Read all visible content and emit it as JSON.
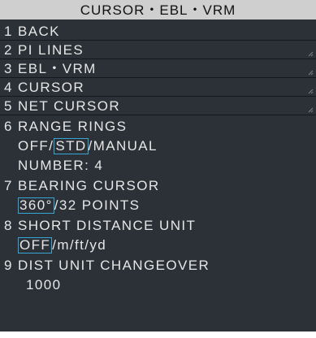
{
  "menu": {
    "title": "CURSOR・EBL・VRM",
    "items": [
      {
        "num": "1",
        "label": "BACK"
      },
      {
        "num": "2",
        "label": "PI LINES"
      },
      {
        "num": "3",
        "label": "EBL・VRM"
      },
      {
        "num": "4",
        "label": "CURSOR"
      },
      {
        "num": "5",
        "label": "NET CURSOR"
      },
      {
        "num": "6",
        "label": "RANGE RINGS"
      },
      {
        "num": "7",
        "label": "BEARING CURSOR"
      },
      {
        "num": "8",
        "label": "SHORT DISTANCE UNIT"
      },
      {
        "num": "9",
        "label": "DIST UNIT CHANGEOVER"
      }
    ],
    "range_rings": {
      "opt_off": "OFF",
      "sep1": "/",
      "opt_std": "STD",
      "sep2": "/",
      "opt_manual": "MANUAL",
      "number_label": "NUMBER: 4"
    },
    "bearing_cursor": {
      "opt_360": "360°",
      "sep": "/",
      "opt_32": "32 POINTS"
    },
    "short_distance_unit": {
      "opt_off": "OFF",
      "sep1": "/",
      "opt_m": "m",
      "sep2": "/",
      "opt_ft": "ft",
      "sep3": "/",
      "opt_yd": "yd"
    },
    "dist_unit_changeover": {
      "value": "1000"
    }
  },
  "colors": {
    "panel_bg": "#2c3137",
    "title_bg": "#cfcfcf",
    "text": "#e6e6e6",
    "highlight_box": "#35a6d6"
  }
}
